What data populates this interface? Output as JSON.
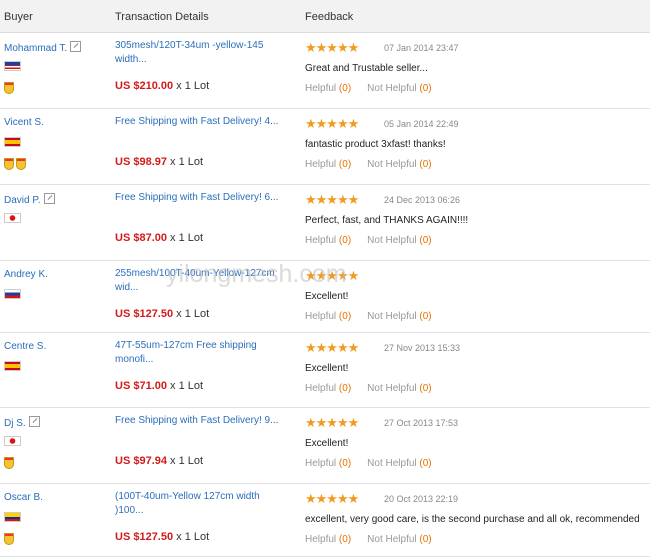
{
  "header": {
    "buyer": "Buyer",
    "transaction": "Transaction Details",
    "feedback": "Feedback"
  },
  "helpful_label": "Helpful",
  "not_helpful_label": "Not Helpful",
  "rows": [
    {
      "buyer": "Mohammad T.",
      "flag": "my",
      "note": true,
      "badges": 1,
      "title": "305mesh/120T-34um -yellow-145\nwidth...",
      "price": "US $210.00",
      "qty": "x 1 Lot",
      "date": "07 Jan 2014 23:47",
      "text": "Great and Trustable seller...",
      "helpful": "(0)",
      "not_helpful": "(0)"
    },
    {
      "buyer": "Vicent S.",
      "flag": "es",
      "note": false,
      "badges": 2,
      "title": "Free Shipping with Fast Delivery! 4...",
      "price": "US $98.97",
      "qty": "x 1 Lot",
      "date": "05 Jan 2014 22:49",
      "text": "fantastic product 3xfast! thanks!",
      "helpful": "(0)",
      "not_helpful": "(0)"
    },
    {
      "buyer": "David P.",
      "flag": "jp",
      "note": true,
      "badges": 0,
      "title": "Free Shipping with Fast Delivery! 6...",
      "price": "US $87.00",
      "qty": "x 1 Lot",
      "date": "24 Dec 2013 06:26",
      "text": "Perfect, fast, and THANKS AGAIN!!!!",
      "helpful": "(0)",
      "not_helpful": "(0)"
    },
    {
      "buyer": "Andrey K.",
      "flag": "ru",
      "note": false,
      "badges": 0,
      "title": "255mesh/100T-40um-Yellow-127cm\nwid...",
      "price": "US $127.50",
      "qty": "x 1 Lot",
      "date": "",
      "text": "Excellent!",
      "helpful": "(0)",
      "not_helpful": "(0)"
    },
    {
      "buyer": "Centre S.",
      "flag": "es",
      "note": false,
      "badges": 0,
      "title": "47T-55um-127cm Free shipping\nmonofi...",
      "price": "US $71.00",
      "qty": "x 1 Lot",
      "date": "27 Nov 2013 15:33",
      "text": "Excellent!",
      "helpful": "(0)",
      "not_helpful": "(0)"
    },
    {
      "buyer": "Dj S.",
      "flag": "jp",
      "note": true,
      "badges": 1,
      "title": "Free Shipping with Fast Delivery! 9...",
      "price": "US $97.94",
      "qty": "x 1 Lot",
      "date": "27 Oct 2013 17:53",
      "text": "Excellent!",
      "helpful": "(0)",
      "not_helpful": "(0)"
    },
    {
      "buyer": "Oscar B.",
      "flag": "ec",
      "note": false,
      "badges": 1,
      "title": "(100T-40um-Yellow 127cm width\n)100...",
      "price": "US $127.50",
      "qty": "x 1 Lot",
      "date": "20 Oct 2013 22:19",
      "text": "excellent, very good care, is the second purchase and all ok, recommended",
      "helpful": "(0)",
      "not_helpful": "(0)"
    }
  ],
  "stars": "★★★★★",
  "watermark": "yilongmesh.com",
  "colors": {
    "link": "#2a6ebb",
    "price": "#d31a1a",
    "star": "#f29a1f",
    "count": "#e67300"
  }
}
